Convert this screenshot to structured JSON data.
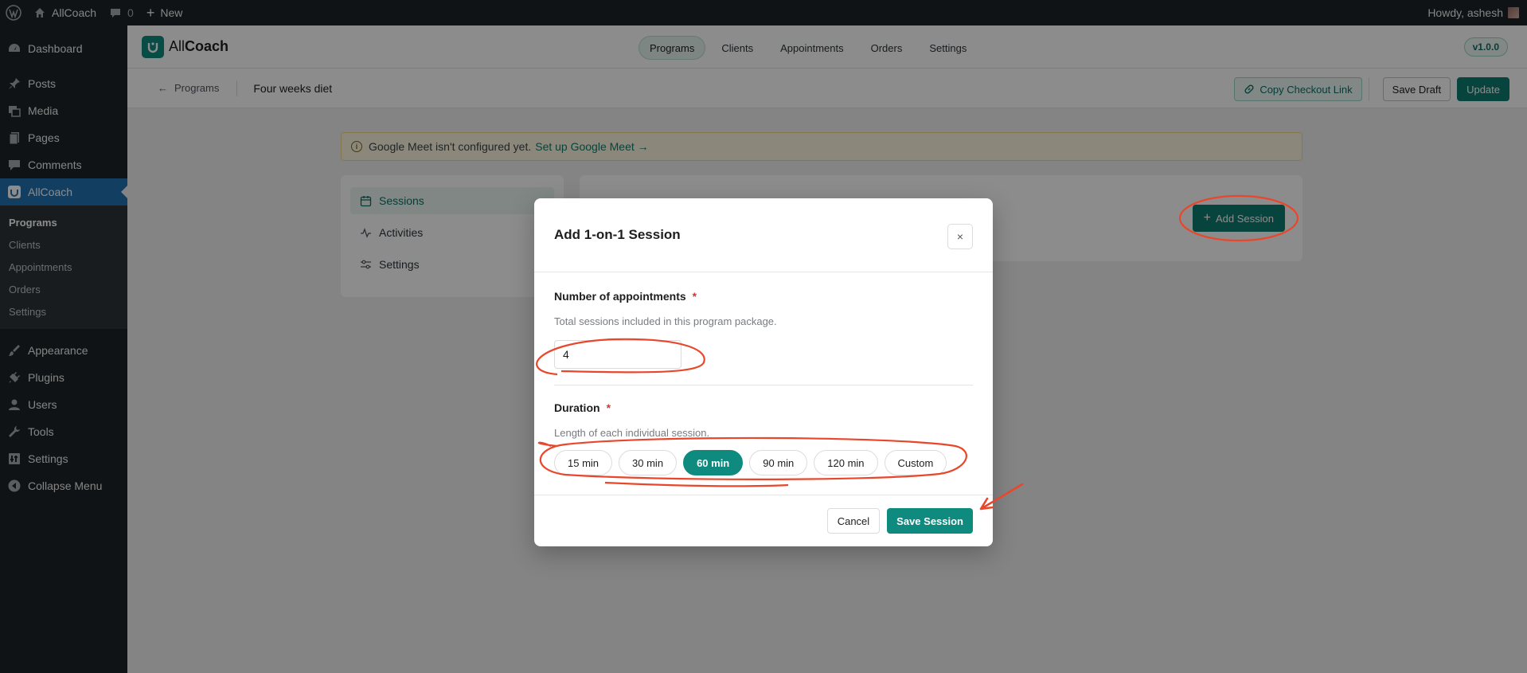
{
  "adminbar": {
    "site_name": "AllCoach",
    "comments_count": "0",
    "new_label": "New",
    "greeting": "Howdy, ashesh"
  },
  "sidebar": {
    "items": [
      {
        "label": "Dashboard",
        "icon": "dashboard-icon"
      },
      {
        "label": "Posts",
        "icon": "pin-icon"
      },
      {
        "label": "Media",
        "icon": "media-icon"
      },
      {
        "label": "Pages",
        "icon": "pages-icon"
      },
      {
        "label": "Comments",
        "icon": "comment-icon"
      },
      {
        "label": "AllCoach",
        "icon": "allcoach-icon"
      }
    ],
    "submenu": [
      "Programs",
      "Clients",
      "Appointments",
      "Orders",
      "Settings"
    ],
    "items_lower": [
      {
        "label": "Appearance",
        "icon": "brush-icon"
      },
      {
        "label": "Plugins",
        "icon": "plugin-icon"
      },
      {
        "label": "Users",
        "icon": "user-icon"
      },
      {
        "label": "Tools",
        "icon": "wrench-icon"
      },
      {
        "label": "Settings",
        "icon": "settings-icon"
      },
      {
        "label": "Collapse Menu",
        "icon": "collapse-icon"
      }
    ]
  },
  "app": {
    "brand_light": "All",
    "brand_bold": "Coach",
    "nav": [
      "Programs",
      "Clients",
      "Appointments",
      "Orders",
      "Settings"
    ],
    "version": "v1.0.0"
  },
  "subheader": {
    "back_label": "Programs",
    "program_title": "Four weeks diet",
    "copy_label": "Copy Checkout Link",
    "draft_label": "Save Draft",
    "update_label": "Update"
  },
  "notice": {
    "text": "Google Meet isn't configured yet.",
    "link": "Set up Google Meet →"
  },
  "program_menu": [
    "Sessions",
    "Activities",
    "Settings"
  ],
  "main": {
    "add_session_label": "Add Session"
  },
  "modal": {
    "title": "Add 1-on-1 Session",
    "close": "×",
    "appointments_label": "Number of appointments",
    "appointments_help": "Total sessions included in this program package.",
    "appointments_value": "4",
    "duration_label": "Duration",
    "duration_help": "Length of each individual session.",
    "durations": [
      "15 min",
      "30 min",
      "60 min",
      "90 min",
      "120 min",
      "Custom"
    ],
    "selected_duration": "60 min",
    "required_mark": "*",
    "cancel_label": "Cancel",
    "save_label": "Save Session"
  },
  "colors": {
    "accent": "#0e8a7e",
    "annotation": "#e8472c"
  }
}
